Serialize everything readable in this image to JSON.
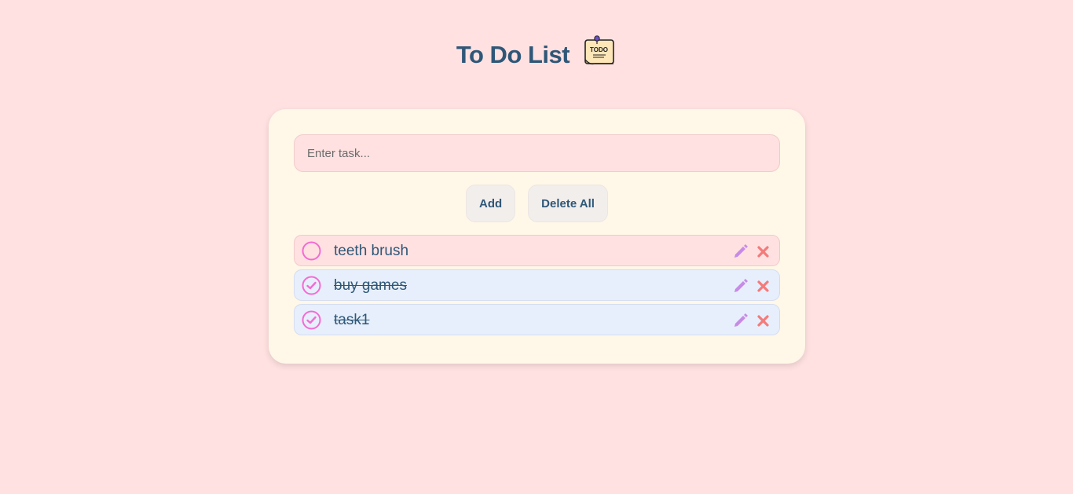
{
  "header": {
    "title": "To Do List",
    "logo_icon": "todo-note-icon",
    "logo_text": "TODO"
  },
  "input": {
    "placeholder": "Enter task...",
    "value": ""
  },
  "buttons": {
    "add_label": "Add",
    "delete_all_label": "Delete All"
  },
  "tasks": [
    {
      "label": "teeth brush",
      "done": false
    },
    {
      "label": "buy games",
      "done": true
    },
    {
      "label": "task1",
      "done": true
    }
  ],
  "colors": {
    "background": "#ffe1e1",
    "card": "#fff7e8",
    "text": "#2f5777",
    "check": "#f46bd3",
    "edit": "#c78be6",
    "delete": "#f47b7b",
    "done_row": "#e7effc"
  }
}
